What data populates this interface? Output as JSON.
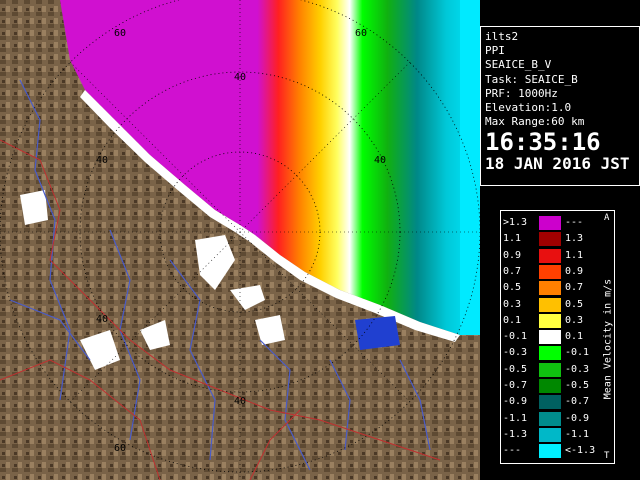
{
  "radar": {
    "range_labels": [
      "60",
      "60",
      "40",
      "40",
      "40",
      "40",
      "40",
      "60"
    ],
    "colors": {
      "land": "#7a6348",
      "land_dark": "#5e4a33",
      "coast": "#ffffff",
      "sea": "#00eaff",
      "river": "#4a5cc8",
      "border": "#c03030",
      "magenta": "#d010d0",
      "ring": "#000000"
    }
  },
  "info": {
    "site": "ilts2",
    "product": "PPI",
    "volume": "SEAICE_B_V",
    "task": "Task: SEAICE_B",
    "prf": "PRF: 1000Hz",
    "elevation": "Elevation:1.0",
    "max_range": "Max Range:60 km",
    "time": "16:35:16",
    "date": "18 JAN 2016 JST"
  },
  "legend": {
    "title": "Mean Velocity in m/s",
    "corner_top": "A",
    "corner_bottom": "T",
    "rows": [
      {
        "hi": ">1.3",
        "lo": "---",
        "color": "#cc00cc"
      },
      {
        "hi": "1.1",
        "lo": "1.3",
        "color": "#a00000"
      },
      {
        "hi": "0.9",
        "lo": "1.1",
        "color": "#e81010"
      },
      {
        "hi": "0.7",
        "lo": "0.9",
        "color": "#ff4000"
      },
      {
        "hi": "0.5",
        "lo": "0.7",
        "color": "#ff8000"
      },
      {
        "hi": "0.3",
        "lo": "0.5",
        "color": "#ffc000"
      },
      {
        "hi": "0.1",
        "lo": "0.3",
        "color": "#ffff40"
      },
      {
        "hi": "-0.1",
        "lo": "0.1",
        "color": "#ffffff"
      },
      {
        "hi": "-0.3",
        "lo": "-0.1",
        "color": "#00ff00"
      },
      {
        "hi": "-0.5",
        "lo": "-0.3",
        "color": "#10c010"
      },
      {
        "hi": "-0.7",
        "lo": "-0.5",
        "color": "#008800"
      },
      {
        "hi": "-0.9",
        "lo": "-0.7",
        "color": "#006060"
      },
      {
        "hi": "-1.1",
        "lo": "-0.9",
        "color": "#008c8c"
      },
      {
        "hi": "-1.3",
        "lo": "-1.1",
        "color": "#00b8c8"
      },
      {
        "hi": "---",
        "lo": "<-1.3",
        "color": "#00f0ff"
      }
    ]
  }
}
